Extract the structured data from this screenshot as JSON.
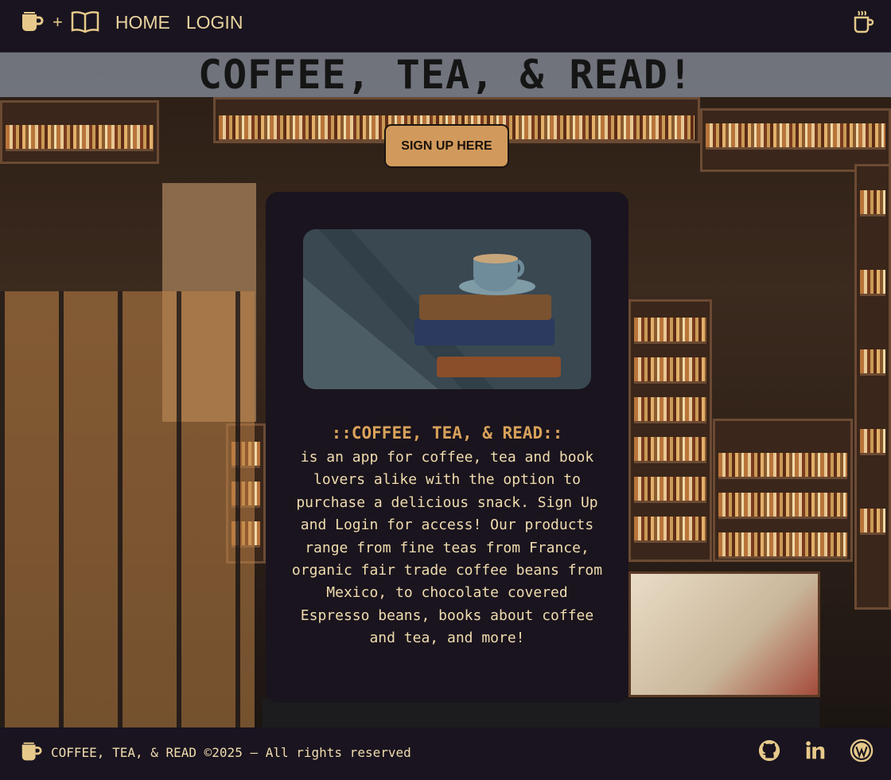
{
  "nav": {
    "brand_icon_coffee": "coffee-cup-icon",
    "plus": "+",
    "brand_icon_book": "open-book-icon",
    "links": [
      "HOME",
      "LOGIN"
    ],
    "right_icon": "coffee-mug-icon"
  },
  "hero": {
    "title": "COFFEE, TEA, & READ!",
    "signup_label": "SIGN UP HERE"
  },
  "card": {
    "heading": "::COFFEE, TEA, & READ::",
    "body": "is an app for coffee, tea and book lovers alike with the option to purchase a delicious snack. Sign Up and Login for access! Our products range from fine teas from France, organic fair trade coffee beans from Mexico, to chocolate covered Espresso beans, books about coffee and tea, and more!"
  },
  "footer": {
    "text": "COFFEE, TEA, & READ ©2025 — All rights reserved",
    "icons": [
      "github-icon",
      "linkedin-icon",
      "wordpress-icon"
    ]
  },
  "colors": {
    "nav_bg": "#19141f",
    "accent_gold": "#e9d39e",
    "button_bg": "#d19a5c",
    "card_bg": "#1a141e",
    "heading_orange": "#d9a25a"
  }
}
